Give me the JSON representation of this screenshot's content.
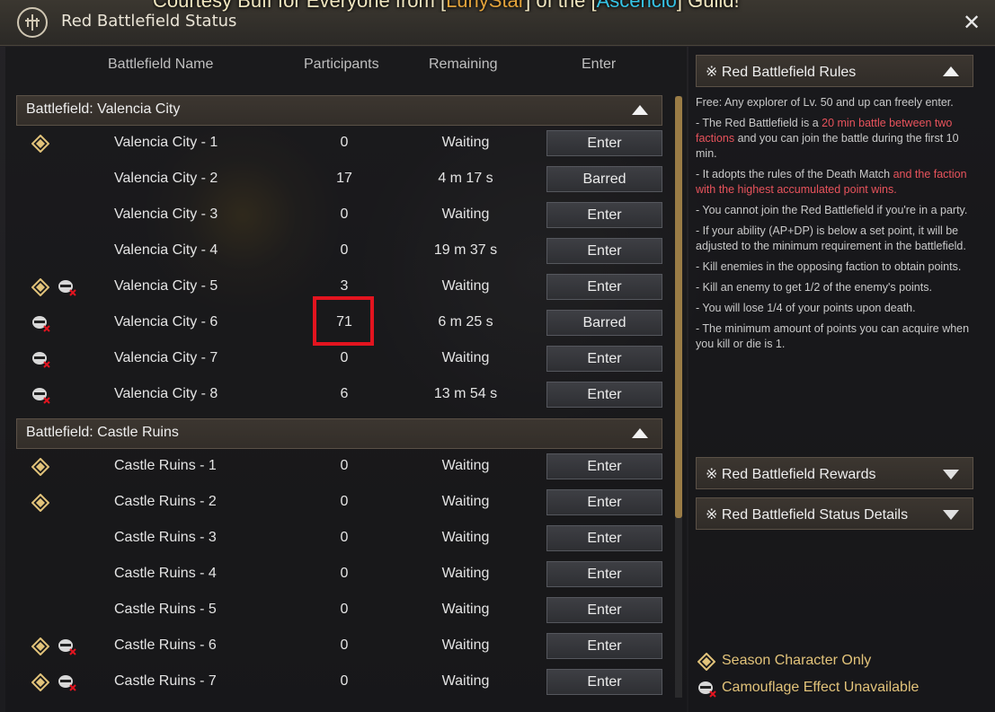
{
  "announcement": {
    "prefix": "Courtesy Buff for Everyone from [",
    "name": "LunyStar",
    "middle": "] of the [",
    "guild": "Ascencio",
    "suffix": "] Guild!"
  },
  "window": {
    "title": "Red Battlefield Status"
  },
  "columns": {
    "name": "Battlefield Name",
    "participants": "Participants",
    "remaining": "Remaining",
    "enter": "Enter"
  },
  "sections": [
    {
      "title": "Battlefield: Valencia City",
      "rows": [
        {
          "name": "Valencia City - 1",
          "participants": "0",
          "remaining": "Waiting",
          "button": "Enter",
          "season": true,
          "camo": false
        },
        {
          "name": "Valencia City - 2",
          "participants": "17",
          "remaining": "4 m 17 s",
          "button": "Barred",
          "season": false,
          "camo": false
        },
        {
          "name": "Valencia City - 3",
          "participants": "0",
          "remaining": "Waiting",
          "button": "Enter",
          "season": false,
          "camo": false
        },
        {
          "name": "Valencia City - 4",
          "participants": "0",
          "remaining": "19 m 37 s",
          "button": "Enter",
          "season": false,
          "camo": false
        },
        {
          "name": "Valencia City - 5",
          "participants": "3",
          "remaining": "Waiting",
          "button": "Enter",
          "season": true,
          "camo": true
        },
        {
          "name": "Valencia City - 6",
          "participants": "71",
          "remaining": "6 m 25 s",
          "button": "Barred",
          "season": false,
          "camo": true
        },
        {
          "name": "Valencia City - 7",
          "participants": "0",
          "remaining": "Waiting",
          "button": "Enter",
          "season": false,
          "camo": true
        },
        {
          "name": "Valencia City - 8",
          "participants": "6",
          "remaining": "13 m 54 s",
          "button": "Enter",
          "season": false,
          "camo": true
        }
      ]
    },
    {
      "title": "Battlefield: Castle Ruins",
      "rows": [
        {
          "name": "Castle Ruins - 1",
          "participants": "0",
          "remaining": "Waiting",
          "button": "Enter",
          "season": true,
          "camo": false
        },
        {
          "name": "Castle Ruins - 2",
          "participants": "0",
          "remaining": "Waiting",
          "button": "Enter",
          "season": true,
          "camo": false
        },
        {
          "name": "Castle Ruins - 3",
          "participants": "0",
          "remaining": "Waiting",
          "button": "Enter",
          "season": false,
          "camo": false
        },
        {
          "name": "Castle Ruins - 4",
          "participants": "0",
          "remaining": "Waiting",
          "button": "Enter",
          "season": false,
          "camo": false
        },
        {
          "name": "Castle Ruins - 5",
          "participants": "0",
          "remaining": "Waiting",
          "button": "Enter",
          "season": false,
          "camo": false
        },
        {
          "name": "Castle Ruins - 6",
          "participants": "0",
          "remaining": "Waiting",
          "button": "Enter",
          "season": true,
          "camo": true
        },
        {
          "name": "Castle Ruins - 7",
          "participants": "0",
          "remaining": "Waiting",
          "button": "Enter",
          "season": true,
          "camo": true
        }
      ]
    }
  ],
  "rules": {
    "title": "※ Red Battlefield Rules",
    "free": "Free: Any explorer of Lv. 50 and up can freely enter.",
    "r1_a": "- The Red Battlefield is a ",
    "r1_red": "20 min battle between two factions",
    "r1_b": " and you can join the battle during the first 10 min.",
    "r2_a": "- It adopts the rules of the Death Match ",
    "r2_red": "and the faction with the highest accumulated point wins.",
    "r3": "- You cannot join the Red Battlefield if you're in a party.",
    "r4": "- If your ability (AP+DP) is below a set point, it will be adjusted to the minimum requirement in the battlefield.",
    "r5": "- Kill enemies in the opposing faction to obtain points.",
    "r6": "- Kill an enemy to get 1/2 of the enemy's points.",
    "r7": "- You will lose 1/4 of your points upon death.",
    "r8": "- The minimum amount of points you can acquire when you kill or die is 1."
  },
  "rewards": {
    "title": "※ Red Battlefield Rewards"
  },
  "status_details": {
    "title": "※ Red Battlefield Status Details"
  },
  "legend": {
    "season": "Season Character Only",
    "camo": "Camouflage Effect Unavailable"
  },
  "colors": {
    "accent_gold": "#e2c37a",
    "rule_red": "#e8535c",
    "highlight_red": "#e3141f"
  }
}
